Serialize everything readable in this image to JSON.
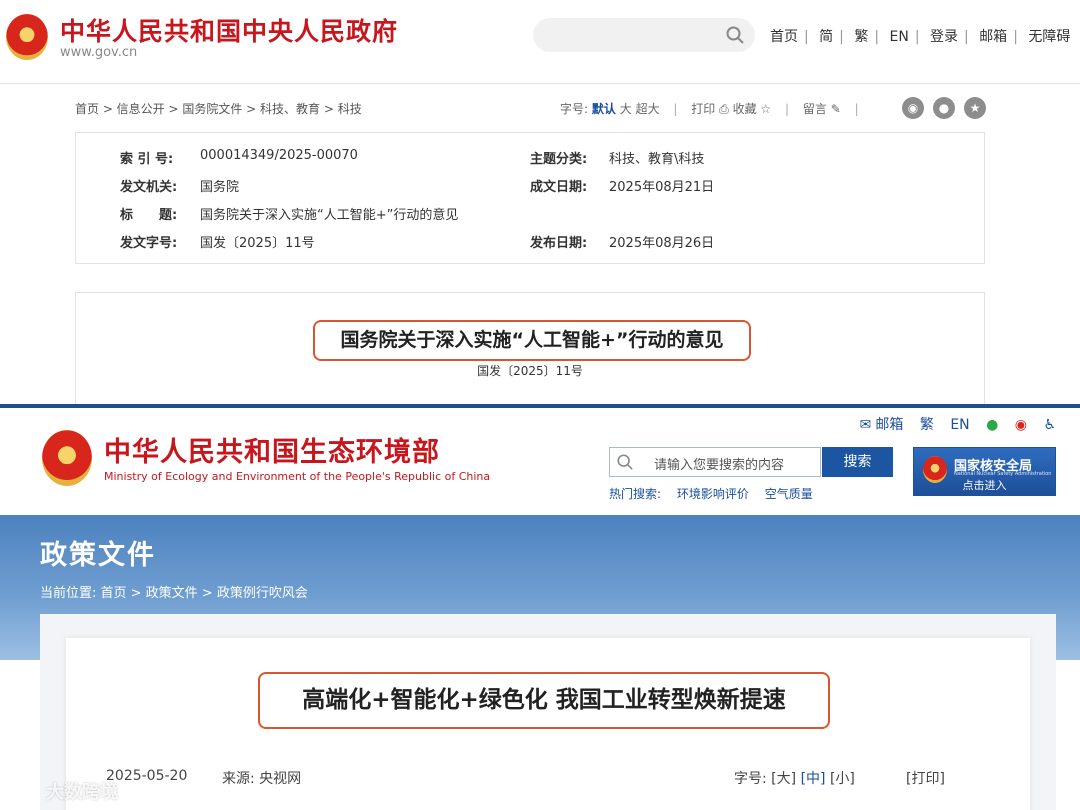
{
  "gov": {
    "site_title": "中华人民共和国中央人民政府",
    "site_url": "www.gov.cn",
    "topnav": [
      "首页",
      "简",
      "繁",
      "EN",
      "登录",
      "邮箱",
      "无障碍"
    ],
    "breadcrumb": "首页 > 信息公开 > 国务院文件 > 科技、教育 > 科技",
    "tools": {
      "font_label": "字号:",
      "font_default": "默认",
      "font_large": "大",
      "font_xlarge": "超大",
      "print": "打印",
      "favorite": "收藏",
      "comment": "留言"
    },
    "meta": {
      "index_label": "索 引 号:",
      "index_value": "000014349/2025-00070",
      "topic_label": "主题分类:",
      "topic_value": "科技、教育\\科技",
      "issuer_label": "发文机关:",
      "issuer_value": "国务院",
      "date_label": "成文日期:",
      "date_value": "2025年08月21日",
      "title_label": "标　　题:",
      "title_value": "国务院关于深入实施“人工智能+”行动的意见",
      "docno_label": "发文字号:",
      "docno_value": "国发〔2025〕11号",
      "pub_label": "发布日期:",
      "pub_value": "2025年08月26日"
    },
    "doc_title": "国务院关于深入实施“人工智能+”行动的意见",
    "doc_number": "国发〔2025〕11号"
  },
  "mee": {
    "util": [
      "邮箱",
      "繁",
      "EN"
    ],
    "site_title": "中华人民共和国生态环境部",
    "site_en": "Ministry of Ecology and Environment of the People's Republic of China",
    "search_placeholder": "请输入您要搜索的内容",
    "search_button": "搜索",
    "hot_label": "热门搜索:",
    "hot_items": [
      "环境影响评价",
      "空气质量"
    ],
    "nsa_title": "国家核安全局",
    "nsa_en": "National Nuclear Safety Administration",
    "nsa_enter": "点击进入",
    "banner_title": "政策文件",
    "breadcrumb": "当前位置: 首页 > 政策文件 > 政策例行吹风会",
    "article_title": "高端化+智能化+绿色化 我国工业转型焕新提速",
    "article_date": "2025-05-20",
    "article_source": "来源: 央视网",
    "font_label": "字号:",
    "font_large": "[大]",
    "font_mid": "[中]",
    "font_small": "[小]",
    "print": "[打印]"
  },
  "watermark": "大数跨境",
  "colors": {
    "gov_red": "#c8161d",
    "mee_blue": "#1c55a1",
    "highlight": "#d9572e"
  }
}
